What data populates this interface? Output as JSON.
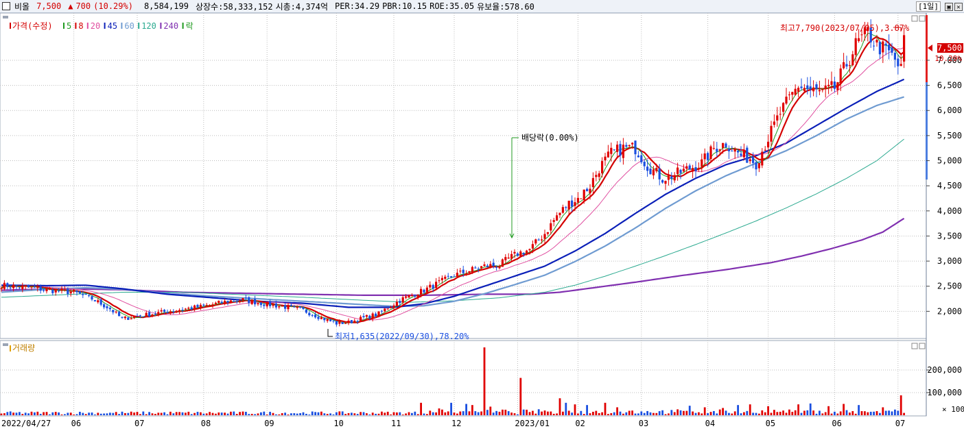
{
  "header": {
    "name": "비올",
    "price": "7,500",
    "change_arrow": "▲",
    "change": "700",
    "change_pct": "(10.29%)",
    "volume": "8,584,199",
    "listed_label": "상장수:58,333,152",
    "mcap_label": "시총:4,374억",
    "per_label": "PER:34.29",
    "pbr_label": "PBR:10.15",
    "roe_label": "ROE:35.05",
    "float_label": "유보율:578.60",
    "period": "[1일]"
  },
  "legend": {
    "price_label": "가격(수정)",
    "ma_items": [
      {
        "label": "5",
        "color": "#1f9a1f"
      },
      {
        "label": "8",
        "color": "#d40000"
      },
      {
        "label": "20",
        "color": "#e04fa0"
      },
      {
        "label": "45",
        "color": "#0a1fb8"
      },
      {
        "label": "60",
        "color": "#6f9bd1"
      },
      {
        "label": "120",
        "color": "#2aa98f"
      },
      {
        "label": "240",
        "color": "#8030b0"
      },
      {
        "label": "락",
        "color": "#1f9a1f"
      }
    ]
  },
  "volume_panel": {
    "title": "거래량",
    "multiplier": "× 100"
  },
  "colors": {
    "up": "#e00000",
    "down": "#1a4fe0",
    "grid": "#bcbcbc"
  },
  "chart_data": {
    "type": "candlestick",
    "price_ylim": [
      1500,
      7900
    ],
    "price_ticks": [
      "2,000",
      "2,500",
      "3,000",
      "3,500",
      "4,000",
      "4,500",
      "5,000",
      "5,500",
      "6,000",
      "6,500",
      "7,000"
    ],
    "price_tick_values": [
      2000,
      2500,
      3000,
      3500,
      4000,
      4500,
      5000,
      5500,
      6000,
      6500,
      7000
    ],
    "x_labels": [
      "2022/04/27",
      "06",
      "07",
      "08",
      "09",
      "10",
      "11",
      "12",
      "2023/01",
      "02",
      "03",
      "04",
      "05",
      "06",
      "07"
    ],
    "x_label_index": [
      0,
      24,
      45,
      67,
      88,
      111,
      130,
      150,
      171,
      191,
      212,
      234,
      254,
      276,
      297
    ],
    "current_price_label": "7,500",
    "current_pct_label": "10.29%",
    "high_annotation": "최고7,790(2023/07/05),3.87%",
    "low_annotation": "최저1,635(2022/09/30),78.20%",
    "dividend_annotation": "배당락(0.00%)",
    "volume_ylim": [
      0,
      300000
    ],
    "volume_ticks": [
      "100,000",
      "200,000"
    ],
    "volume_tick_values": [
      100000,
      200000
    ],
    "price_anchors": [
      [
        0,
        2520
      ],
      [
        8,
        2480
      ],
      [
        16,
        2420
      ],
      [
        24,
        2380
      ],
      [
        30,
        2250
      ],
      [
        36,
        2050
      ],
      [
        40,
        1850
      ],
      [
        45,
        1900
      ],
      [
        55,
        2000
      ],
      [
        67,
        2100
      ],
      [
        75,
        2200
      ],
      [
        80,
        2230
      ],
      [
        88,
        2140
      ],
      [
        95,
        2080
      ],
      [
        100,
        2020
      ],
      [
        106,
        1870
      ],
      [
        111,
        1760
      ],
      [
        115,
        1780
      ],
      [
        120,
        1870
      ],
      [
        125,
        1950
      ],
      [
        128,
        2080
      ],
      [
        133,
        2250
      ],
      [
        140,
        2420
      ],
      [
        150,
        2720
      ],
      [
        160,
        2900
      ],
      [
        165,
        2920
      ],
      [
        168,
        3050
      ],
      [
        171,
        3150
      ],
      [
        175,
        3230
      ],
      [
        180,
        3550
      ],
      [
        184,
        3900
      ],
      [
        188,
        4150
      ],
      [
        191,
        4250
      ],
      [
        195,
        4500
      ],
      [
        198,
        4850
      ],
      [
        202,
        5150
      ],
      [
        206,
        5250
      ],
      [
        210,
        5250
      ],
      [
        214,
        4900
      ],
      [
        219,
        4650
      ],
      [
        223,
        4720
      ],
      [
        228,
        4850
      ],
      [
        232,
        4950
      ],
      [
        236,
        5250
      ],
      [
        240,
        5350
      ],
      [
        245,
        5100
      ],
      [
        248,
        5050
      ],
      [
        250,
        4950
      ],
      [
        254,
        5450
      ],
      [
        258,
        5950
      ],
      [
        264,
        6500
      ],
      [
        268,
        6400
      ],
      [
        272,
        6350
      ],
      [
        276,
        6450
      ],
      [
        279,
        6800
      ],
      [
        283,
        7300
      ],
      [
        287,
        7550
      ],
      [
        290,
        7300
      ],
      [
        294,
        7150
      ],
      [
        296,
        7000
      ],
      [
        298,
        6800
      ],
      [
        299,
        7500
      ]
    ],
    "ma_anchors": {
      "ma45": [
        [
          0,
          2520
        ],
        [
          15,
          2510
        ],
        [
          28,
          2520
        ],
        [
          40,
          2450
        ],
        [
          55,
          2340
        ],
        [
          70,
          2270
        ],
        [
          85,
          2200
        ],
        [
          100,
          2160
        ],
        [
          115,
          2080
        ],
        [
          130,
          2080
        ],
        [
          140,
          2150
        ],
        [
          150,
          2300
        ],
        [
          160,
          2500
        ],
        [
          170,
          2700
        ],
        [
          180,
          2900
        ],
        [
          190,
          3200
        ],
        [
          200,
          3550
        ],
        [
          210,
          3950
        ],
        [
          220,
          4330
        ],
        [
          230,
          4650
        ],
        [
          240,
          4920
        ],
        [
          250,
          5100
        ],
        [
          260,
          5350
        ],
        [
          270,
          5700
        ],
        [
          280,
          6050
        ],
        [
          290,
          6380
        ],
        [
          299,
          6620
        ]
      ],
      "ma60": [
        [
          0,
          2380
        ],
        [
          15,
          2440
        ],
        [
          28,
          2470
        ],
        [
          40,
          2440
        ],
        [
          55,
          2360
        ],
        [
          70,
          2300
        ],
        [
          85,
          2250
        ],
        [
          100,
          2200
        ],
        [
          115,
          2150
        ],
        [
          130,
          2100
        ],
        [
          140,
          2110
        ],
        [
          150,
          2200
        ],
        [
          160,
          2350
        ],
        [
          170,
          2530
        ],
        [
          180,
          2720
        ],
        [
          190,
          2990
        ],
        [
          200,
          3300
        ],
        [
          210,
          3660
        ],
        [
          220,
          4050
        ],
        [
          230,
          4400
        ],
        [
          240,
          4700
        ],
        [
          250,
          4950
        ],
        [
          260,
          5200
        ],
        [
          270,
          5500
        ],
        [
          280,
          5830
        ],
        [
          290,
          6100
        ],
        [
          299,
          6270
        ]
      ],
      "ma120": [
        [
          0,
          2280
        ],
        [
          20,
          2330
        ],
        [
          40,
          2380
        ],
        [
          60,
          2380
        ],
        [
          80,
          2330
        ],
        [
          100,
          2280
        ],
        [
          120,
          2220
        ],
        [
          135,
          2180
        ],
        [
          150,
          2210
        ],
        [
          165,
          2270
        ],
        [
          180,
          2380
        ],
        [
          190,
          2520
        ],
        [
          200,
          2700
        ],
        [
          210,
          2900
        ],
        [
          220,
          3110
        ],
        [
          230,
          3330
        ],
        [
          240,
          3560
        ],
        [
          250,
          3800
        ],
        [
          260,
          4060
        ],
        [
          270,
          4340
        ],
        [
          280,
          4650
        ],
        [
          290,
          5000
        ],
        [
          299,
          5430
        ]
      ],
      "ma240": [
        [
          0,
          2420
        ],
        [
          20,
          2450
        ],
        [
          40,
          2430
        ],
        [
          60,
          2380
        ],
        [
          80,
          2360
        ],
        [
          100,
          2340
        ],
        [
          120,
          2320
        ],
        [
          140,
          2320
        ],
        [
          160,
          2340
        ],
        [
          175,
          2340
        ],
        [
          185,
          2380
        ],
        [
          195,
          2460
        ],
        [
          210,
          2580
        ],
        [
          225,
          2710
        ],
        [
          240,
          2830
        ],
        [
          255,
          2970
        ],
        [
          265,
          3100
        ],
        [
          275,
          3250
        ],
        [
          285,
          3420
        ],
        [
          292,
          3580
        ],
        [
          299,
          3850
        ]
      ]
    },
    "volume_spikes": [
      [
        160,
        300000
      ],
      [
        172,
        165000
      ],
      [
        298,
        88000
      ],
      [
        139,
        55000
      ],
      [
        145,
        30000
      ],
      [
        146,
        25000
      ],
      [
        149,
        55000
      ],
      [
        154,
        50000
      ],
      [
        156,
        45000
      ],
      [
        162,
        38000
      ],
      [
        168,
        18000
      ],
      [
        185,
        75000
      ],
      [
        187,
        55000
      ],
      [
        190,
        48000
      ],
      [
        194,
        45000
      ],
      [
        200,
        55000
      ],
      [
        204,
        35000
      ],
      [
        228,
        42000
      ],
      [
        233,
        35000
      ],
      [
        239,
        32000
      ],
      [
        244,
        45000
      ],
      [
        248,
        48000
      ],
      [
        254,
        40000
      ],
      [
        264,
        48000
      ],
      [
        268,
        52000
      ],
      [
        274,
        40000
      ],
      [
        279,
        50000
      ],
      [
        284,
        45000
      ],
      [
        292,
        35000
      ],
      [
        296,
        25000
      ]
    ]
  }
}
